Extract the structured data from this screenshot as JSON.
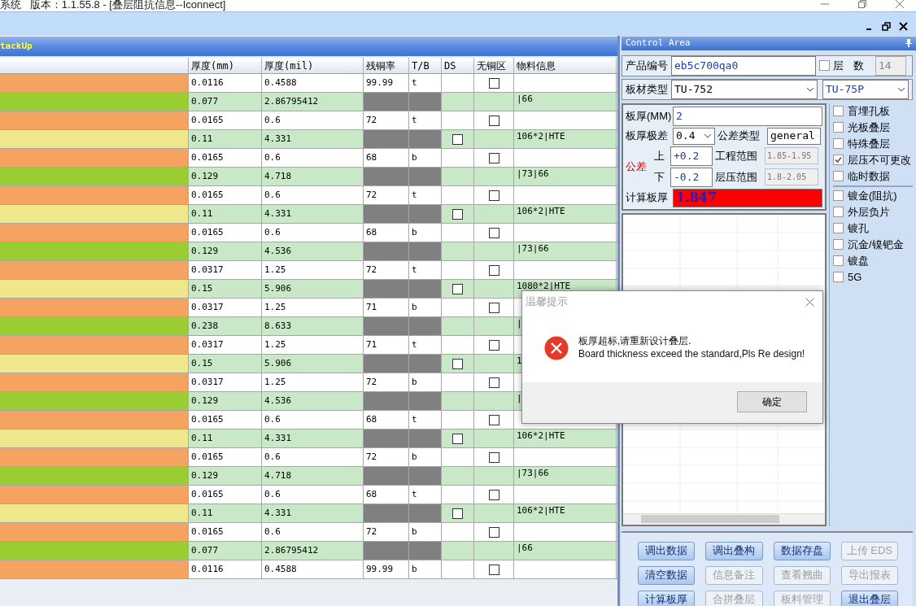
{
  "window": {
    "title": "系统   版本：1.1.55.8 - [叠层阻抗信息--Iconnect]"
  },
  "stackup": {
    "title": "tackUp",
    "columns": [
      "厚度(mm)",
      "厚度(mil)",
      "残铜率",
      "T/B",
      "DS",
      "无铜区",
      "物料信息"
    ],
    "rows": [
      {
        "kind": "copper",
        "color": "#f4a460",
        "mm": "0.0116",
        "mil": "0.4588",
        "residual": "99.99",
        "tb": "t",
        "checked": false
      },
      {
        "kind": "core",
        "color": "#9acd32",
        "mm": "0.077",
        "mil": "2.86795412",
        "material": "|66"
      },
      {
        "kind": "copper",
        "color": "#f4a460",
        "mm": "0.0165",
        "mil": "0.6",
        "residual": "72",
        "tb": "t",
        "checked": false
      },
      {
        "kind": "prepreg",
        "color": "#f0e68c",
        "mm": "0.11",
        "mil": "4.331",
        "checked": false,
        "material": "106*2|HTE"
      },
      {
        "kind": "copper",
        "color": "#f4a460",
        "mm": "0.0165",
        "mil": "0.6",
        "residual": "68",
        "tb": "b",
        "checked": false
      },
      {
        "kind": "core",
        "color": "#9acd32",
        "mm": "0.129",
        "mil": "4.718",
        "material": "|73|66"
      },
      {
        "kind": "copper",
        "color": "#f4a460",
        "mm": "0.0165",
        "mil": "0.6",
        "residual": "72",
        "tb": "t",
        "checked": false
      },
      {
        "kind": "prepreg",
        "color": "#f0e68c",
        "mm": "0.11",
        "mil": "4.331",
        "checked": false,
        "material": "106*2|HTE"
      },
      {
        "kind": "copper",
        "color": "#f4a460",
        "mm": "0.0165",
        "mil": "0.6",
        "residual": "68",
        "tb": "b",
        "checked": false
      },
      {
        "kind": "core",
        "color": "#9acd32",
        "mm": "0.129",
        "mil": "4.536",
        "material": "|73|66"
      },
      {
        "kind": "copper",
        "color": "#f4a460",
        "mm": "0.0317",
        "mil": "1.25",
        "residual": "72",
        "tb": "t",
        "checked": false
      },
      {
        "kind": "prepreg",
        "color": "#f0e68c",
        "mm": "0.15",
        "mil": "5.906",
        "checked": false,
        "material": "1080*2|HTE"
      },
      {
        "kind": "copper",
        "color": "#f4a460",
        "mm": "0.0317",
        "mil": "1.25",
        "residual": "71",
        "tb": "b",
        "checked": false
      },
      {
        "kind": "core",
        "color": "#9acd32",
        "mm": "0.238",
        "mil": "8.633",
        "material": "|"
      },
      {
        "kind": "copper",
        "color": "#f4a460",
        "mm": "0.0317",
        "mil": "1.25",
        "residual": "71",
        "tb": "t",
        "checked": false
      },
      {
        "kind": "prepreg",
        "color": "#f0e68c",
        "mm": "0.15",
        "mil": "5.906",
        "checked": false,
        "material": "1"
      },
      {
        "kind": "copper",
        "color": "#f4a460",
        "mm": "0.0317",
        "mil": "1.25",
        "residual": "72",
        "tb": "b",
        "checked": false
      },
      {
        "kind": "core",
        "color": "#9acd32",
        "mm": "0.129",
        "mil": "4.536",
        "material": "|"
      },
      {
        "kind": "copper",
        "color": "#f4a460",
        "mm": "0.0165",
        "mil": "0.6",
        "residual": "68",
        "tb": "t",
        "checked": false
      },
      {
        "kind": "prepreg",
        "color": "#f0e68c",
        "mm": "0.11",
        "mil": "4.331",
        "checked": false,
        "material": "106*2|HTE"
      },
      {
        "kind": "copper",
        "color": "#f4a460",
        "mm": "0.0165",
        "mil": "0.6",
        "residual": "72",
        "tb": "b",
        "checked": false
      },
      {
        "kind": "core",
        "color": "#9acd32",
        "mm": "0.129",
        "mil": "4.718",
        "material": "|73|66"
      },
      {
        "kind": "copper",
        "color": "#f4a460",
        "mm": "0.0165",
        "mil": "0.6",
        "residual": "68",
        "tb": "t",
        "checked": false
      },
      {
        "kind": "prepreg",
        "color": "#f0e68c",
        "mm": "0.11",
        "mil": "4.331",
        "checked": false,
        "material": "106*2|HTE"
      },
      {
        "kind": "copper",
        "color": "#f4a460",
        "mm": "0.0165",
        "mil": "0.6",
        "residual": "72",
        "tb": "b",
        "checked": false
      },
      {
        "kind": "core",
        "color": "#9acd32",
        "mm": "0.077",
        "mil": "2.86795412",
        "material": "|66"
      },
      {
        "kind": "copper",
        "color": "#f4a460",
        "mm": "0.0116",
        "mil": "0.4588",
        "residual": "99.99",
        "tb": "b",
        "checked": false
      }
    ]
  },
  "control_area": {
    "title": "Control Area",
    "product_no": {
      "label": "产品编号",
      "value": "eb5c700qa0"
    },
    "layers": {
      "label_1": "层",
      "label_2": "数",
      "checked": false,
      "value": "14"
    },
    "material": {
      "label": "板材类型",
      "value": "TU-752",
      "value_2": "TU-75P"
    },
    "thickness": {
      "label": "板厚(MM)",
      "value": "2"
    },
    "range": {
      "label": "板厚极差",
      "value": "0.4"
    },
    "tolerance_type": {
      "label": "公差类型",
      "value": "general"
    },
    "tolerance_label": "公差",
    "upper": {
      "label": "上",
      "value": "+0.2"
    },
    "lower": {
      "label": "下",
      "value": "-0.2"
    },
    "engineering_range": {
      "label": "工程范围",
      "value": "1.85-1.95"
    },
    "lamination_range": {
      "label": "层压范围",
      "value": "1.8-2.05"
    },
    "calculated": {
      "label": "计算板厚",
      "value": "1.847"
    },
    "options_1": [
      {
        "label": "盲埋孔板",
        "checked": false
      },
      {
        "label": "光板叠层",
        "checked": false
      },
      {
        "label": "特殊叠层",
        "checked": false
      },
      {
        "label": "层压不可更改",
        "checked": true
      },
      {
        "label": "临时数据",
        "checked": false
      }
    ],
    "options_2": [
      {
        "label": "镀金(阻抗)",
        "checked": false
      },
      {
        "label": "外层负片",
        "checked": false
      },
      {
        "label": "镀孔",
        "checked": false
      },
      {
        "label": "沉金/镍钯金",
        "checked": false
      },
      {
        "label": "镀盘",
        "checked": false
      },
      {
        "label": "5G",
        "checked": false
      }
    ],
    "buttons": [
      {
        "label": "调出数据",
        "disabled": false
      },
      {
        "label": "调出叠构",
        "disabled": false
      },
      {
        "label": "数据存盘",
        "disabled": false
      },
      {
        "label": "上传 EDS",
        "disabled": true
      },
      {
        "label": "清空数据",
        "disabled": false
      },
      {
        "label": "信息备注",
        "disabled": true
      },
      {
        "label": "查看翘曲",
        "disabled": true
      },
      {
        "label": "导出报表",
        "disabled": true
      },
      {
        "label": "计算板厚",
        "disabled": false
      },
      {
        "label": "合拼叠层",
        "disabled": true
      },
      {
        "label": "板料管理",
        "disabled": true
      },
      {
        "label": "退出叠层",
        "disabled": false
      }
    ]
  },
  "dialog": {
    "title": "温馨提示",
    "message_1": "板厚超标,请重新设计叠层.",
    "message_2": "Board thickness exceed the standard,Pls Re design!",
    "button": "确定"
  }
}
